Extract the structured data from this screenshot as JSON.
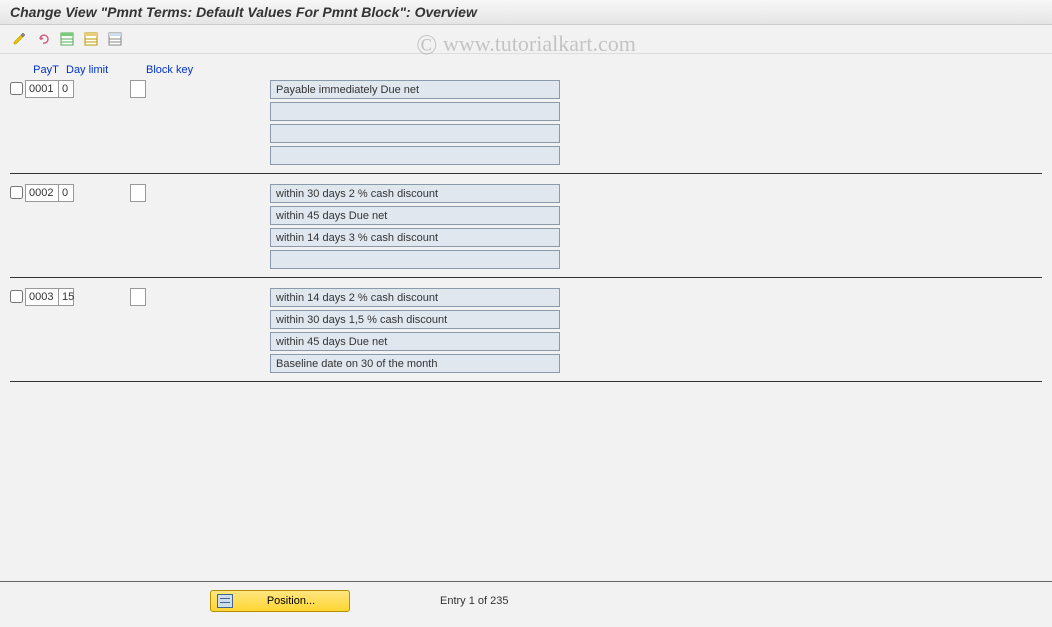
{
  "title": "Change View \"Pmnt Terms: Default Values For Pmnt Block\": Overview",
  "watermark": "www.tutorialkart.com",
  "toolbar": {
    "icons": [
      "change-icon",
      "undo-icon",
      "select-all-icon",
      "select-block-icon",
      "deselect-icon"
    ]
  },
  "headers": {
    "payt": "PayT",
    "day": "Day limit",
    "block": "Block key"
  },
  "rows": [
    {
      "payt": "0001",
      "day": "0",
      "block": "",
      "descriptions": [
        "Payable immediately Due net",
        "",
        "",
        ""
      ]
    },
    {
      "payt": "0002",
      "day": "0",
      "block": "",
      "descriptions": [
        "within 30 days 2 % cash discount",
        "within 45 days Due net",
        "within 14 days 3 % cash discount",
        ""
      ]
    },
    {
      "payt": "0003",
      "day": "15",
      "block": "",
      "descriptions": [
        "within 14 days 2 % cash discount",
        "within 30 days 1,5 % cash discount",
        "within 45 days Due net",
        "Baseline date on 30 of the month"
      ]
    }
  ],
  "footer": {
    "position_label": "Position...",
    "entry_text": "Entry 1 of 235"
  }
}
